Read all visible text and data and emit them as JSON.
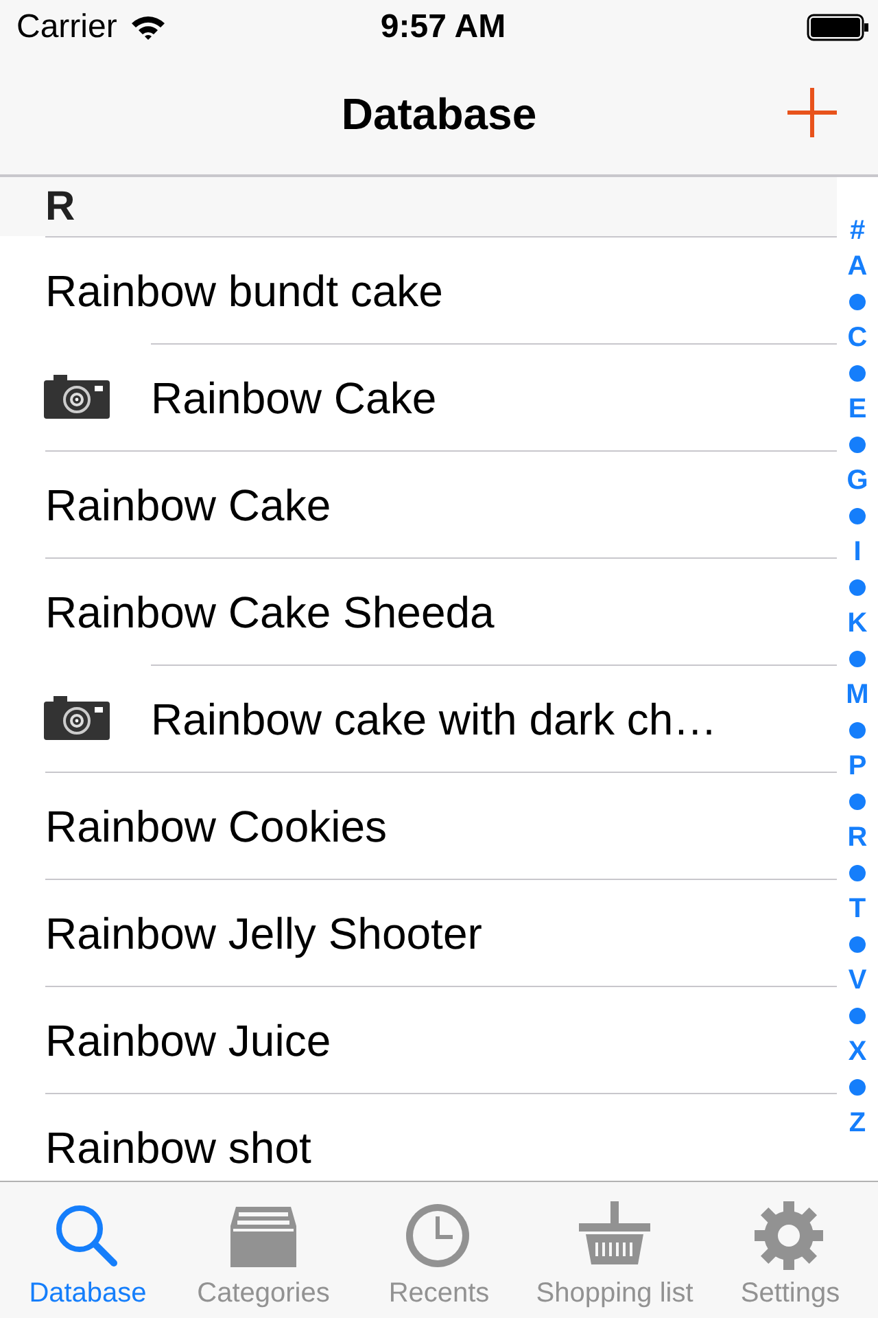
{
  "status_bar": {
    "carrier": "Carrier",
    "time": "9:57 AM"
  },
  "nav_bar": {
    "title": "Database"
  },
  "section": {
    "header": "R"
  },
  "rows": [
    {
      "title": "Rainbow bundt cake",
      "has_photo": false
    },
    {
      "title": "Rainbow Cake",
      "has_photo": true
    },
    {
      "title": "Rainbow Cake",
      "has_photo": false
    },
    {
      "title": "Rainbow Cake Sheeda",
      "has_photo": false
    },
    {
      "title": "Rainbow cake with dark ch…",
      "has_photo": true
    },
    {
      "title": "Rainbow Cookies",
      "has_photo": false
    },
    {
      "title": "Rainbow Jelly Shooter",
      "has_photo": false
    },
    {
      "title": "Rainbow Juice",
      "has_photo": false
    },
    {
      "title": "Rainbow shot",
      "has_photo": false
    }
  ],
  "index": [
    {
      "kind": "letter",
      "label": "#"
    },
    {
      "kind": "letter",
      "label": "A"
    },
    {
      "kind": "dot"
    },
    {
      "kind": "letter",
      "label": "C"
    },
    {
      "kind": "dot"
    },
    {
      "kind": "letter",
      "label": "E"
    },
    {
      "kind": "dot"
    },
    {
      "kind": "letter",
      "label": "G"
    },
    {
      "kind": "dot"
    },
    {
      "kind": "letter",
      "label": "I"
    },
    {
      "kind": "dot"
    },
    {
      "kind": "letter",
      "label": "K"
    },
    {
      "kind": "dot"
    },
    {
      "kind": "letter",
      "label": "M"
    },
    {
      "kind": "dot"
    },
    {
      "kind": "letter",
      "label": "P"
    },
    {
      "kind": "dot"
    },
    {
      "kind": "letter",
      "label": "R"
    },
    {
      "kind": "dot"
    },
    {
      "kind": "letter",
      "label": "T"
    },
    {
      "kind": "dot"
    },
    {
      "kind": "letter",
      "label": "V"
    },
    {
      "kind": "dot"
    },
    {
      "kind": "letter",
      "label": "X"
    },
    {
      "kind": "dot"
    },
    {
      "kind": "letter",
      "label": "Z"
    }
  ],
  "tabs": [
    {
      "label": "Database",
      "selected": true
    },
    {
      "label": "Categories",
      "selected": false
    },
    {
      "label": "Recents",
      "selected": false
    },
    {
      "label": "Shopping list",
      "selected": false
    },
    {
      "label": "Settings",
      "selected": false
    }
  ]
}
